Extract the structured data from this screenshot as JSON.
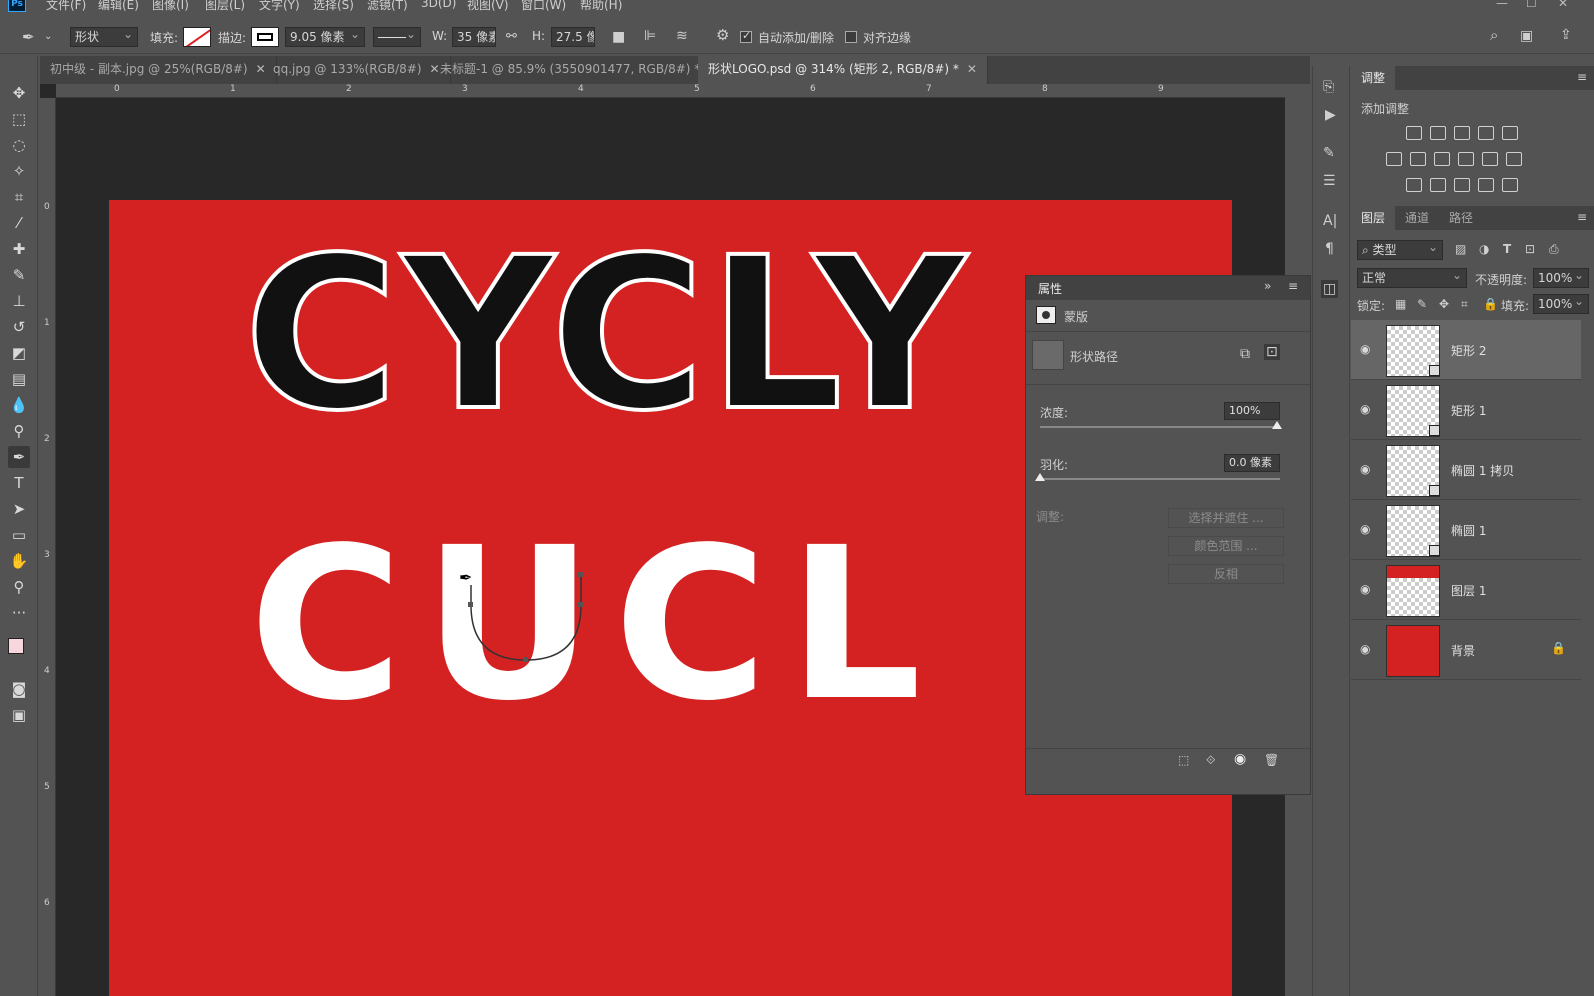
{
  "app": {
    "logo": "Ps"
  },
  "menu": [
    "文件(F)",
    "编辑(E)",
    "图像(I)",
    "图层(L)",
    "文字(Y)",
    "选择(S)",
    "滤镜(T)",
    "3D(D)",
    "视图(V)",
    "窗口(W)",
    "帮助(H)"
  ],
  "options": {
    "tool_mode": "形状",
    "fill_label": "填充:",
    "stroke_label": "描边:",
    "stroke_width": "9.05 像素",
    "w_label": "W:",
    "w_value": "35 像素",
    "h_label": "H:",
    "h_value": "27.5 像素",
    "auto_add_delete": "自动添加/删除",
    "align_edges": "对齐边缘"
  },
  "tabs": [
    {
      "label": "初中级 - 副本.jpg @ 25%(RGB/8#)",
      "active": false
    },
    {
      "label": "qq.jpg @ 133%(RGB/8#)",
      "active": false
    },
    {
      "label": "未标题-1 @ 85.9% (3550901477, RGB/8#) *",
      "active": false
    },
    {
      "label": "形状LOGO.psd @ 314% (矩形 2, RGB/8#) *",
      "active": true
    }
  ],
  "ruler": {
    "top": [
      "0",
      "1",
      "2",
      "3",
      "4",
      "5",
      "6",
      "7",
      "8",
      "9"
    ],
    "left": [
      "0",
      "1",
      "2",
      "3",
      "4",
      "5",
      "6"
    ]
  },
  "artwork": {
    "line1": "CYCLY",
    "line2": "CUCL",
    "accent": "#d42222"
  },
  "adjustments": {
    "tab": "调整",
    "add_label": "添加调整"
  },
  "layers_panel": {
    "tabs": [
      "图层",
      "通道",
      "路径"
    ],
    "filter": "类型",
    "blend_mode": "正常",
    "opacity_label": "不透明度:",
    "opacity_value": "100%",
    "lock_label": "锁定:",
    "fill_label": "填充:",
    "fill_value": "100%",
    "layers": [
      {
        "name": "矩形 2",
        "selected": true,
        "visible": true
      },
      {
        "name": "矩形 1",
        "selected": false,
        "visible": true
      },
      {
        "name": "椭圆 1 拷贝",
        "selected": false,
        "visible": true
      },
      {
        "name": "椭圆 1",
        "selected": false,
        "visible": true
      },
      {
        "name": "图层 1",
        "selected": false,
        "visible": true
      },
      {
        "name": "背景",
        "selected": false,
        "visible": true,
        "locked": true
      }
    ]
  },
  "properties": {
    "title": "属性",
    "mask_label": "蒙版",
    "vector_mask_label": "形状路径",
    "density_label": "浓度:",
    "density_value": "100%",
    "feather_label": "羽化:",
    "feather_value": "0.0 像素",
    "refine_label": "调整:",
    "btn_select_mask": "选择并遮住 ...",
    "btn_color_range": "颜色范围 ...",
    "btn_invert": "反相"
  }
}
